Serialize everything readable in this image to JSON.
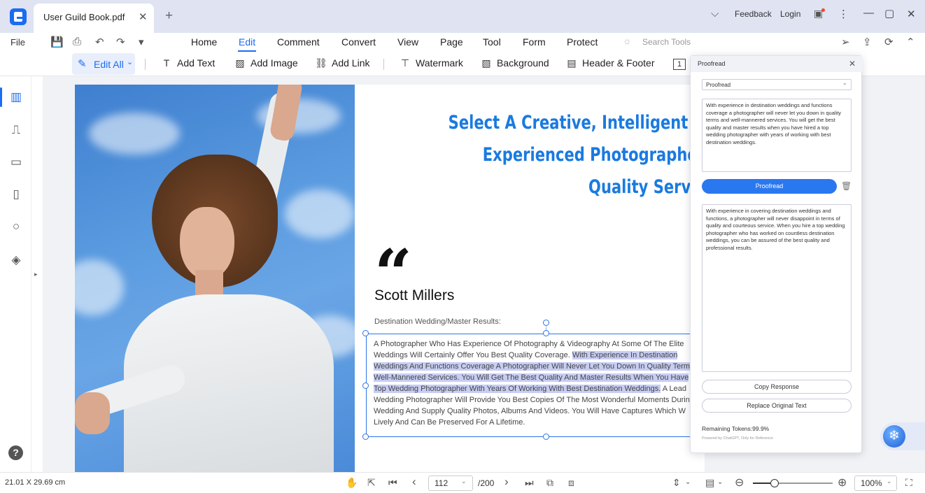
{
  "titlebar": {
    "tab_title": "User Guild Book.pdf",
    "close_glyph": "✕",
    "new_tab_glyph": "+",
    "feedback": "Feedback",
    "login": "Login",
    "chevron_glyph": "⌵",
    "notify_glyph": "▣",
    "more_glyph": "⋮",
    "minimize_glyph": "—",
    "maximize_glyph": "▢",
    "close_window_glyph": "✕"
  },
  "menubar": {
    "file": "File",
    "quick_icons": [
      "💾",
      "⎙",
      "↶",
      "↷",
      "▾"
    ],
    "tabs": [
      "Home",
      "Edit",
      "Comment",
      "Convert",
      "View",
      "Page",
      "Tool",
      "Form",
      "Protect"
    ],
    "active_tab": "Edit",
    "search_placeholder": "Search Tools",
    "right_icons": [
      "➢",
      "⇪",
      "⟳",
      "⌃"
    ]
  },
  "toolbar": {
    "edit_all": "Edit All",
    "edit_all_icon": "✎",
    "edit_all_chevron": "⌄",
    "items": [
      {
        "icon": "T",
        "label": "Add Text"
      },
      {
        "icon": "▨",
        "label": "Add Image"
      },
      {
        "icon": "⛓",
        "label": "Add Link"
      },
      {
        "icon": "⊤",
        "label": "Watermark"
      },
      {
        "icon": "▧",
        "label": "Background"
      },
      {
        "icon": "▤",
        "label": "Header & Footer"
      },
      {
        "icon": "1",
        "label": ""
      }
    ]
  },
  "left_rail": {
    "icons": [
      "▥",
      "⎍",
      "▭",
      "▯",
      "○",
      "◈"
    ],
    "expand_glyph": "▸",
    "help": "?"
  },
  "document": {
    "headline_lines": [
      "Select A Creative, Intelligent A",
      "Experienced Photographer",
      "Quality Servic"
    ],
    "quote_mark": "“",
    "author": "Scott Millers",
    "subtitle": "Destination Wedding/Master Results:",
    "body_plain_start": "A Photographer Who Has Experience Of Photography & Videography At Some Of The Elite Weddings Will Certainly Offer You Best Quality Coverage. ",
    "body_highlight": "With Experience In Destination Weddings And Functions Coverage A Photographer Will Never Let You Down In Quality Term Well-Mannered Services. You Will Get The Best Quality And Master Results When You Have Top Wedding Photographer With Years Of Working With Best Destination Weddings.",
    "body_plain_end": " A Lead Wedding Photographer Will Provide You Best Copies Of The Most Wonderful Moments Durin Wedding And Supply Quality Photos, Albums And Videos. You Will Have Captures Which W Lively And Can Be Preserved For A Lifetime."
  },
  "proofread_panel": {
    "title": "Proofread",
    "close_glyph": "✕",
    "mode": "Proofread",
    "mode_chevron": "⌄",
    "input_text": "With experience in destination weddings and functions coverage a photographer will never let you down in quality terms and well-mannered services. You will get the best quality and master results when you have hired a top wedding photographer with years of working with best destination weddings.",
    "proofread_button": "Proofread",
    "trash_glyph": "🗑",
    "output_text": "With experience in covering destination weddings and functions, a photographer will never disappoint in terms of quality and courteous service. When you hire a top wedding photographer who has worked on countless destination weddings, you can be assured of the best quality and professional results.",
    "copy_button": "Copy Response",
    "replace_button": "Replace Original Text",
    "remaining_tokens": "Remaining Tokens:99.9%",
    "powered_by": "Powered by ChatGPT, Only for Reference"
  },
  "ai_fab": {
    "glyph": "❄"
  },
  "statusbar": {
    "page_size": "21.01 X 29.69 cm",
    "nav_icons": [
      "✋",
      "⇱",
      "⏮",
      "‹",
      "›",
      "⏭",
      "⧉",
      "⧈"
    ],
    "current_page": "112",
    "total_pages": "/200",
    "chevron": "⌄",
    "right_icons": [
      "⇕",
      "⌄",
      "▤",
      "⌄",
      "⊖",
      "⊕",
      "⛶"
    ],
    "zoom": "100%",
    "zoom_fraction": 0.27
  }
}
